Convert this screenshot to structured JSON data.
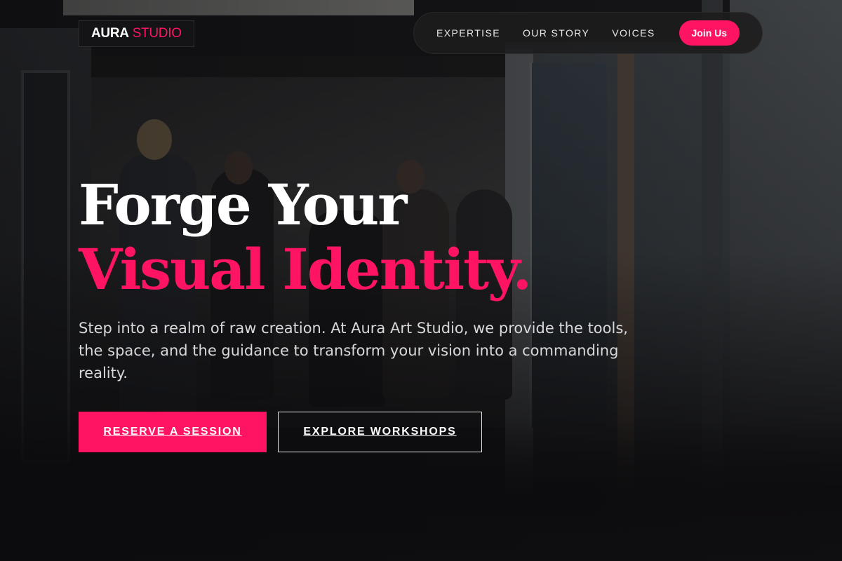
{
  "brand": {
    "name_primary": "AURA",
    "name_accent": "STUDIO",
    "accent_color": "#ff1463"
  },
  "nav": {
    "items": [
      {
        "label": "EXPERTISE"
      },
      {
        "label": "OUR STORY"
      },
      {
        "label": "VOICES"
      }
    ],
    "cta_label": "Join Us"
  },
  "hero": {
    "title_line1": "Forge Your",
    "title_line2": "Visual Identity.",
    "subtitle": "Step into a realm of raw creation. At Aura Art Studio, we provide the tools, the space, and the guidance to transform your vision into a commanding reality.",
    "primary_button": "RESERVE A SESSION",
    "secondary_button": "EXPLORE WORKSHOPS"
  }
}
